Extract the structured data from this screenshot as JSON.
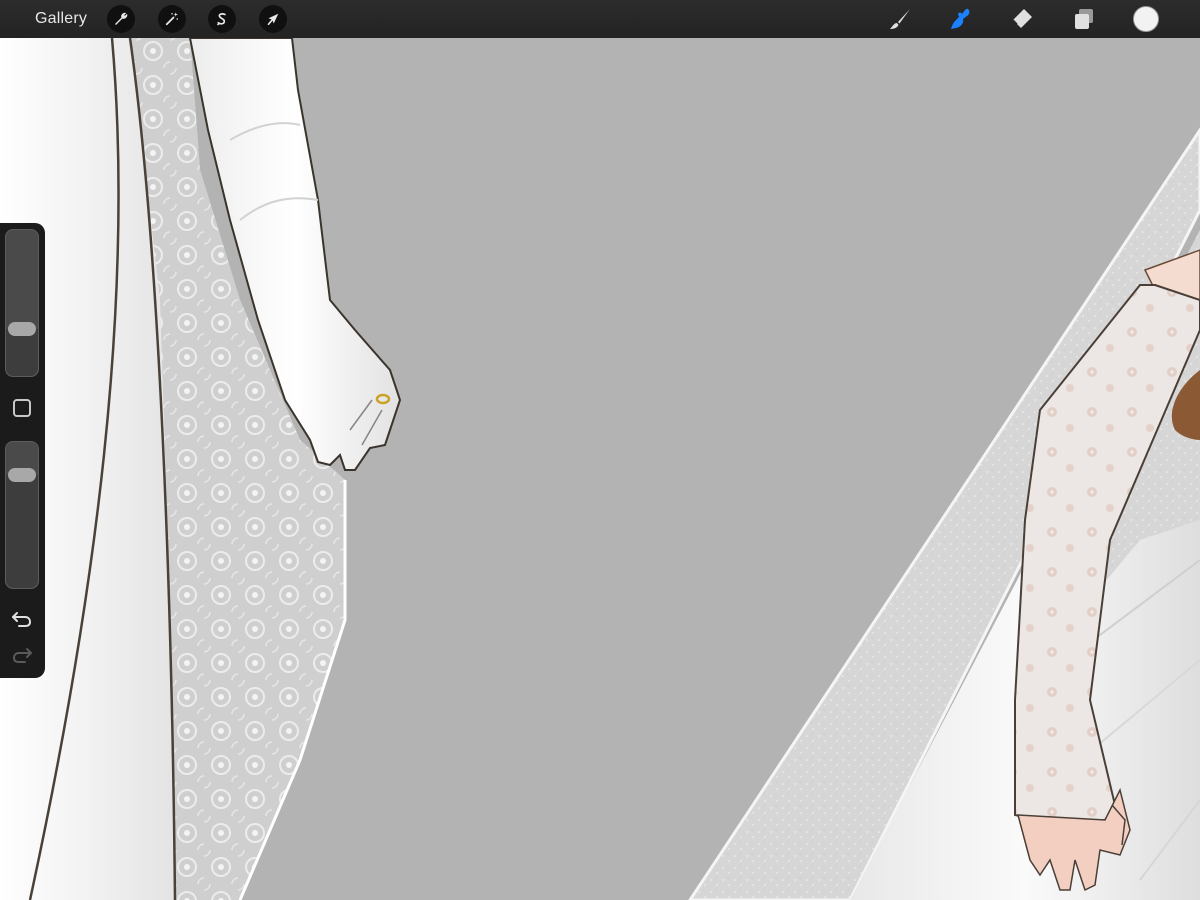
{
  "toolbar": {
    "gallery_label": "Gallery",
    "left_tools": [
      {
        "name": "actions",
        "icon": "wrench-icon"
      },
      {
        "name": "adjustments",
        "icon": "magic-wand-icon"
      },
      {
        "name": "selection",
        "icon": "selection-s-icon"
      },
      {
        "name": "transform",
        "icon": "arrow-cursor-icon"
      }
    ],
    "right_tools": [
      {
        "name": "paint",
        "icon": "brush-icon",
        "active": false
      },
      {
        "name": "smudge",
        "icon": "smudge-finger-icon",
        "active": true
      },
      {
        "name": "erase",
        "icon": "eraser-icon",
        "active": false
      },
      {
        "name": "layers",
        "icon": "layers-icon",
        "active": false
      }
    ],
    "active_color": "#f2f2f2",
    "accent_color": "#1a82ff"
  },
  "sidebar": {
    "brush_size_level": 0.3,
    "opacity_level": 0.8,
    "modify_button": "square-icon",
    "undo": "undo-arrow-icon",
    "redo": "redo-arrow-icon"
  },
  "canvas": {
    "background_color": "#b3b3b3",
    "subject": "bridal-gown-illustration"
  }
}
